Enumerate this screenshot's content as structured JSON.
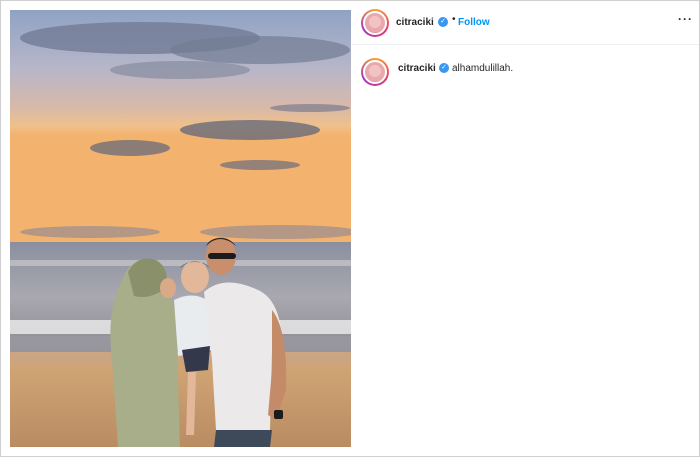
{
  "post": {
    "username": "citraciki",
    "verified_icon": "verified-badge-icon",
    "separator": "•",
    "follow_label": "Follow",
    "more_label": "···",
    "caption": "alhamdulillah."
  },
  "colors": {
    "follow": "#0095f6",
    "verified": "#3897f0"
  }
}
